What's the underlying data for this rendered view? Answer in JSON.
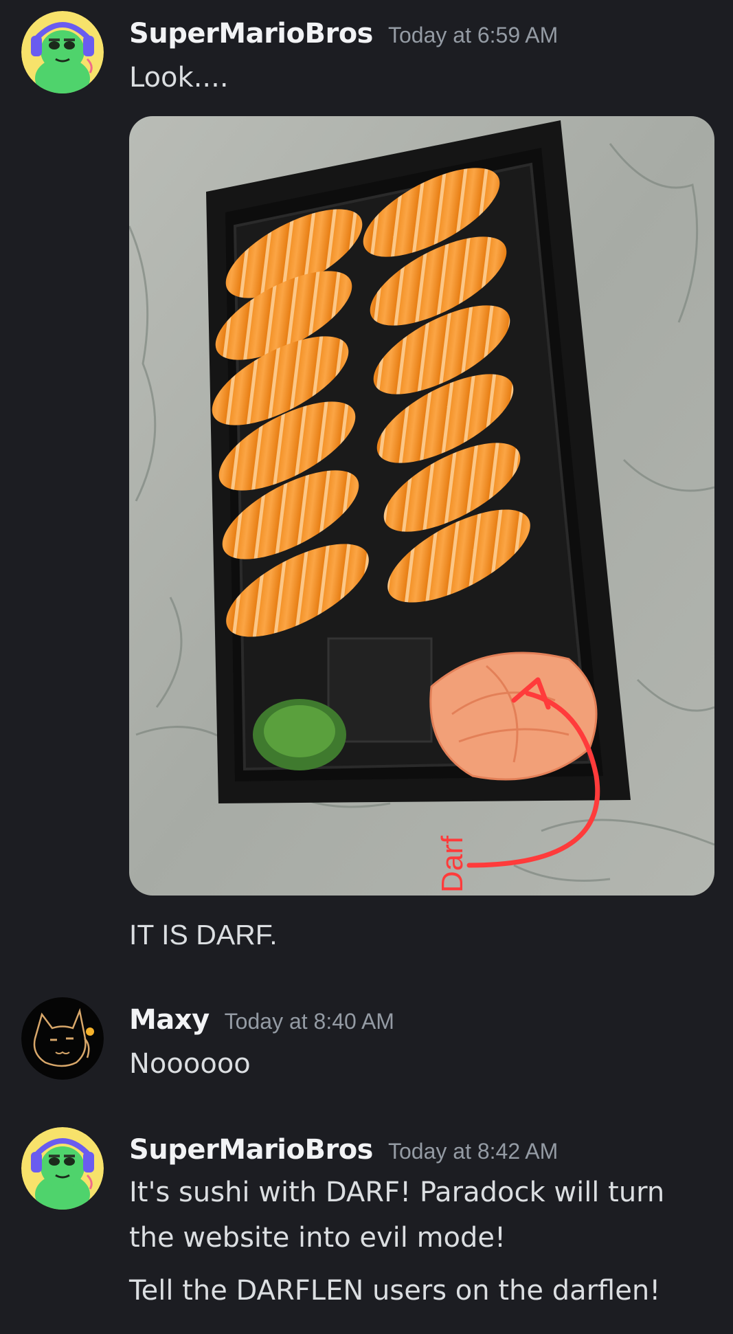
{
  "messages": [
    {
      "username": "SuperMarioBros",
      "timestamp": "Today at 6:59 AM",
      "lines": [
        "Look...."
      ],
      "avatar_icon": "green-frog-headset-avatar"
    },
    {
      "attachment": {
        "icon": "sushi-photo",
        "annotation": "Darf"
      },
      "lines": [
        "IT IS DARF."
      ]
    },
    {
      "username": "Maxy",
      "timestamp": "Today at 8:40 AM",
      "lines": [
        "Noooooo"
      ],
      "avatar_icon": "black-cat-doodle-avatar"
    },
    {
      "username": "SuperMarioBros",
      "timestamp": "Today at 8:42 AM",
      "lines": [
        "It's sushi with DARF! Paradock will turn",
        "the website into evil mode!",
        "Tell the DARFLEN users on the darflen!"
      ],
      "avatar_icon": "green-frog-headset-avatar"
    }
  ],
  "colors": {
    "background": "#1c1d22",
    "username": "#f2f3f5",
    "timestamp": "#949ba4",
    "text": "#dbdee1",
    "annotation": "#ff3b3b"
  }
}
